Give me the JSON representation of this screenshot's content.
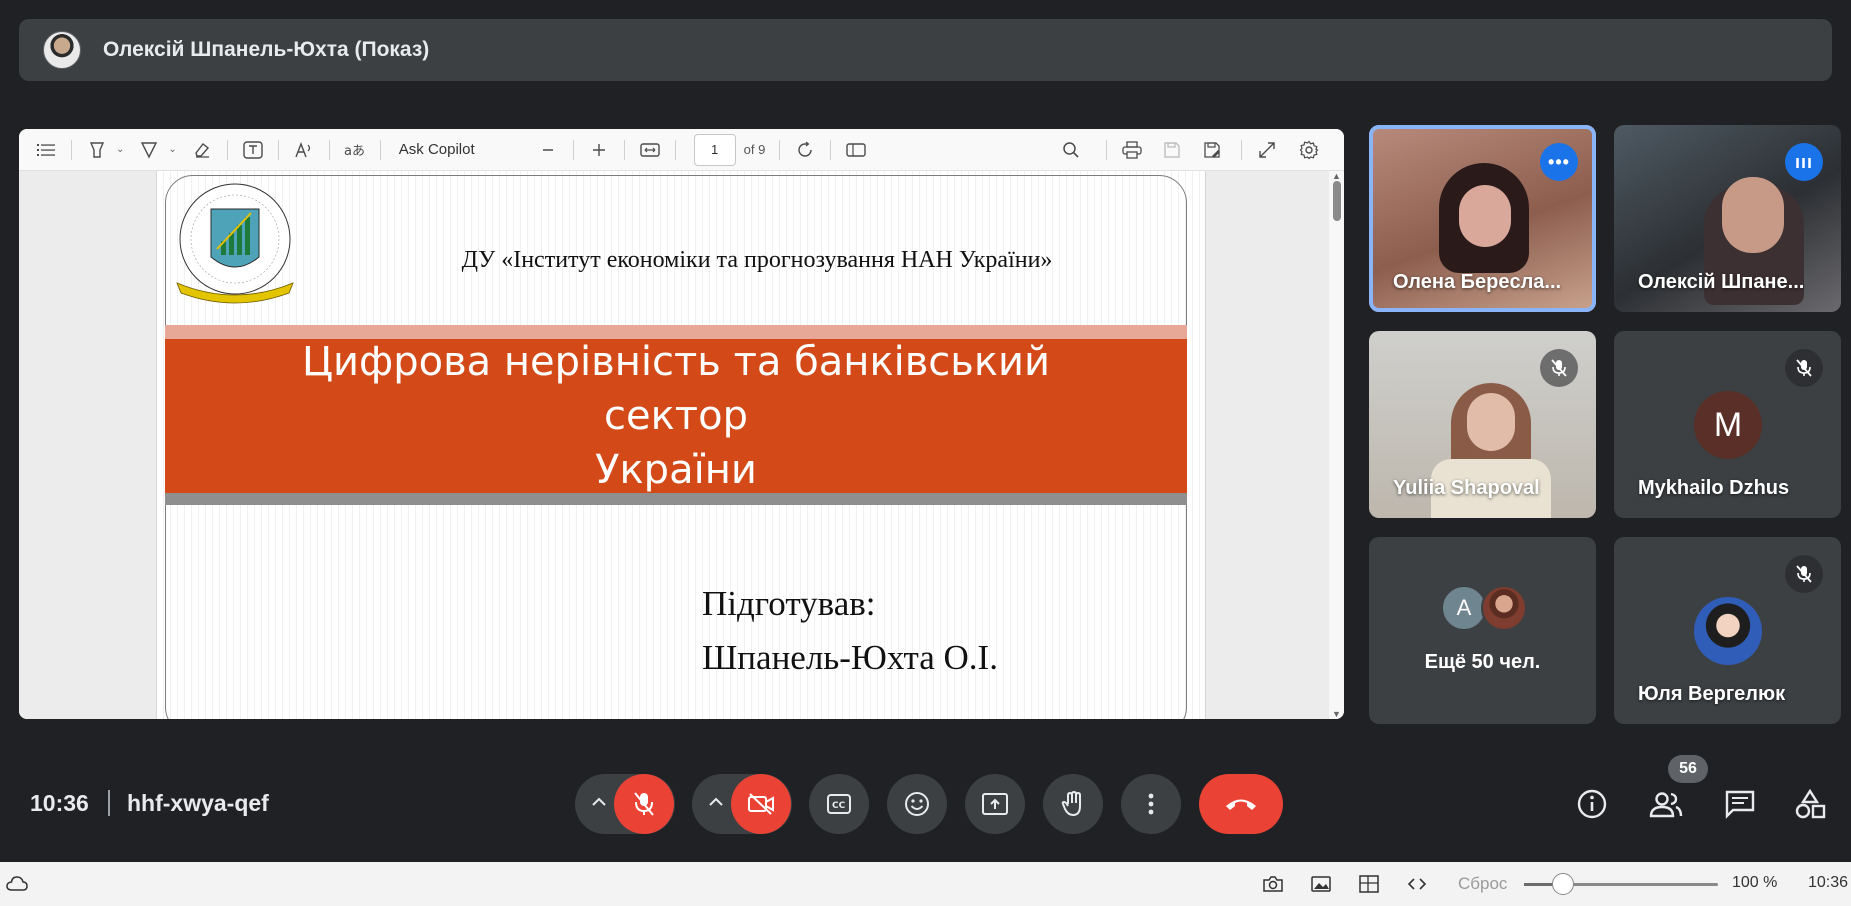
{
  "presenter": {
    "name": "Олексій Шпанель-Юхта (Показ)"
  },
  "pdf": {
    "toolbar": {
      "ask_copilot": "Ask Copilot",
      "page_current": "1",
      "page_total": "of 9"
    },
    "slide": {
      "institute": "ДУ «Інститут економіки та прогнозування НАН України»",
      "title_line1": "Цифрова нерівність та банківський сектор",
      "title_line2": "України",
      "prepared_label": "Підготував:",
      "prepared_name": "Шпанель-Юхта О.І."
    }
  },
  "participants": [
    {
      "name": "Олена Берeсла...",
      "state": "speaking"
    },
    {
      "name": "Олексій Шпане...",
      "state": "speaking"
    },
    {
      "name": "Yuliia Shapoval",
      "state": "muted"
    },
    {
      "name": "Mykhailo Dzhus",
      "initial": "M",
      "state": "muted"
    },
    {
      "more_label": "Ещё 50 чел.",
      "initial": "A"
    },
    {
      "name": "Юля Вергелюк",
      "state": "muted"
    }
  ],
  "meeting": {
    "time": "10:36",
    "code": "hhf-xwya-qef",
    "participant_count": "56"
  },
  "os": {
    "reset_label": "Сброс",
    "zoom": "100 %",
    "zoom_fraction": 0.2,
    "time": "10:36"
  },
  "colors": {
    "accent_blue": "#1a73e8",
    "end_red": "#ea4335",
    "active_outline": "#8ab4f8",
    "slide_orange": "#d34a18"
  }
}
